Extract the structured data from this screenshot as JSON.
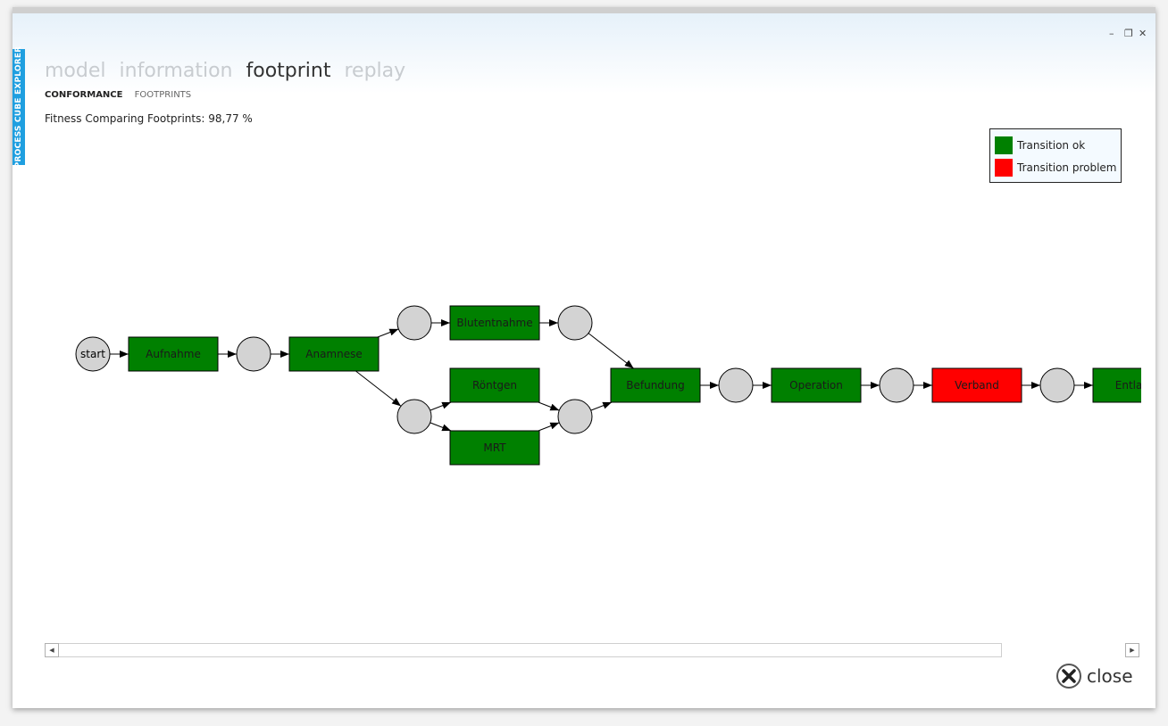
{
  "window": {
    "side_tab": "PROCESS CUBE EXPLORER",
    "controls": {
      "minimize": "–",
      "restore": "❐",
      "close": "✕"
    }
  },
  "nav": {
    "tabs": [
      {
        "label": "model",
        "active": false
      },
      {
        "label": "information",
        "active": false
      },
      {
        "label": "footprint",
        "active": true
      },
      {
        "label": "replay",
        "active": false
      }
    ]
  },
  "subnav": {
    "tabs": [
      {
        "label": "CONFORMANCE",
        "active": true
      },
      {
        "label": "FOOTPRINTS",
        "active": false
      }
    ]
  },
  "fitness_text": "Fitness Comparing Footprints: 98,77 %",
  "legend": {
    "items": [
      {
        "label": "Transition ok",
        "color": "#008000"
      },
      {
        "label": "Transition problem",
        "color": "#ff0000"
      }
    ]
  },
  "graph": {
    "colors": {
      "ok": "#008000",
      "problem": "#ff0000",
      "place": "#d3d3d3"
    },
    "places": [
      {
        "id": "p0",
        "label": "start"
      },
      {
        "id": "p1",
        "label": ""
      },
      {
        "id": "p2",
        "label": ""
      },
      {
        "id": "p3",
        "label": ""
      },
      {
        "id": "p4",
        "label": ""
      },
      {
        "id": "p5",
        "label": ""
      },
      {
        "id": "p6",
        "label": ""
      },
      {
        "id": "p7",
        "label": ""
      },
      {
        "id": "p8",
        "label": ""
      }
    ],
    "transitions": [
      {
        "id": "t_aufnahme",
        "label": "Aufnahme",
        "status": "ok"
      },
      {
        "id": "t_anamnese",
        "label": "Anamnese",
        "status": "ok"
      },
      {
        "id": "t_blutentnahme",
        "label": "Blutentnahme",
        "status": "ok"
      },
      {
        "id": "t_roentgen",
        "label": "Röntgen",
        "status": "ok"
      },
      {
        "id": "t_mrt",
        "label": "MRT",
        "status": "ok"
      },
      {
        "id": "t_befundung",
        "label": "Befundung",
        "status": "ok"
      },
      {
        "id": "t_operation",
        "label": "Operation",
        "status": "ok"
      },
      {
        "id": "t_verband",
        "label": "Verband",
        "status": "problem"
      },
      {
        "id": "t_entlassen",
        "label": "Entlasse",
        "status": "ok"
      }
    ],
    "arcs": [
      [
        "p0",
        "t_aufnahme"
      ],
      [
        "t_aufnahme",
        "p1"
      ],
      [
        "p1",
        "t_anamnese"
      ],
      [
        "t_anamnese",
        "p2"
      ],
      [
        "t_anamnese",
        "p3"
      ],
      [
        "p2",
        "t_blutentnahme"
      ],
      [
        "t_blutentnahme",
        "p4"
      ],
      [
        "p4",
        "t_befundung"
      ],
      [
        "p3",
        "t_roentgen"
      ],
      [
        "p3",
        "t_mrt"
      ],
      [
        "t_roentgen",
        "p5"
      ],
      [
        "t_mrt",
        "p5"
      ],
      [
        "p5",
        "t_befundung"
      ],
      [
        "t_befundung",
        "p6"
      ],
      [
        "p6",
        "t_operation"
      ],
      [
        "t_operation",
        "p7"
      ],
      [
        "p7",
        "t_verband"
      ],
      [
        "t_verband",
        "p8"
      ],
      [
        "p8",
        "t_entlassen"
      ]
    ]
  },
  "close_label": "close"
}
